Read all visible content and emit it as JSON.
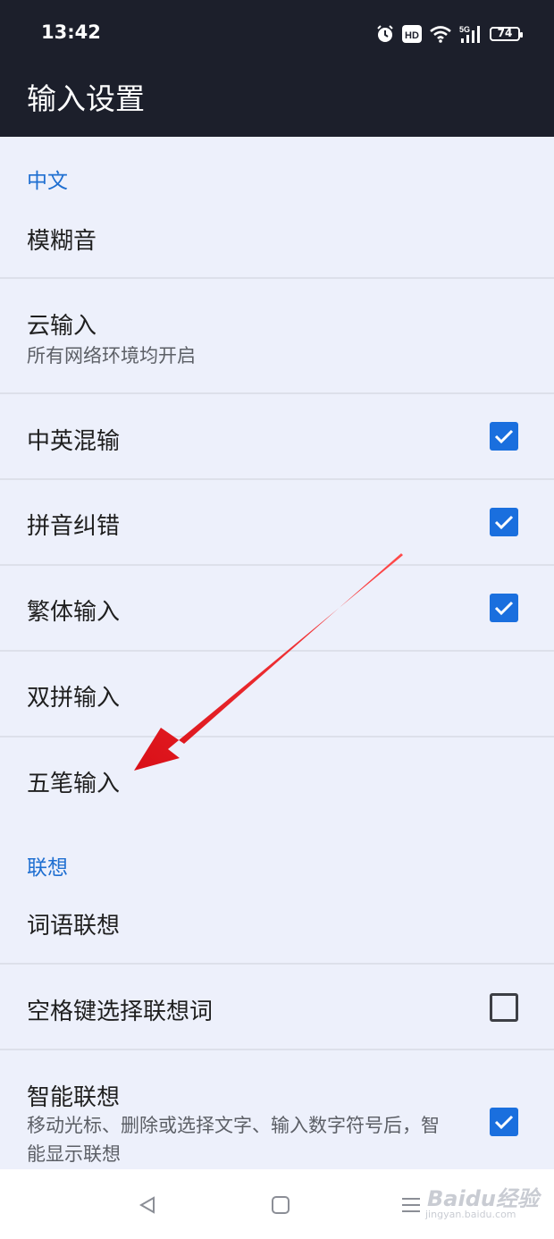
{
  "status_bar": {
    "time": "13:42",
    "network": "5G",
    "hd": "HD",
    "battery": "74"
  },
  "header": {
    "title": "输入设置"
  },
  "sections": [
    {
      "label": "中文",
      "items": [
        {
          "title": "模糊音"
        },
        {
          "title": "云输入",
          "subtitle": "所有网络环境均开启"
        },
        {
          "title": "中英混输",
          "checked": true
        },
        {
          "title": "拼音纠错",
          "checked": true
        },
        {
          "title": "繁体输入",
          "checked": true
        },
        {
          "title": "双拼输入"
        },
        {
          "title": "五笔输入"
        }
      ]
    },
    {
      "label": "联想",
      "items": [
        {
          "title": "词语联想"
        },
        {
          "title": "空格键选择联想词",
          "checked": false
        },
        {
          "title": "智能联想",
          "subtitle": "移动光标、删除或选择文字、输入数字符号后，智能显示联想",
          "checked": true
        }
      ]
    }
  ],
  "annotation": {
    "color": "#e8141c",
    "points_to": "五笔输入"
  },
  "nav_bar": {
    "watermark": "Baidu经验",
    "watermark_sub": "jingyan.baidu.com"
  },
  "colors": {
    "accent": "#1a6fde",
    "header_bg": "#1c1f2b",
    "page_bg": "#edf0fb"
  }
}
